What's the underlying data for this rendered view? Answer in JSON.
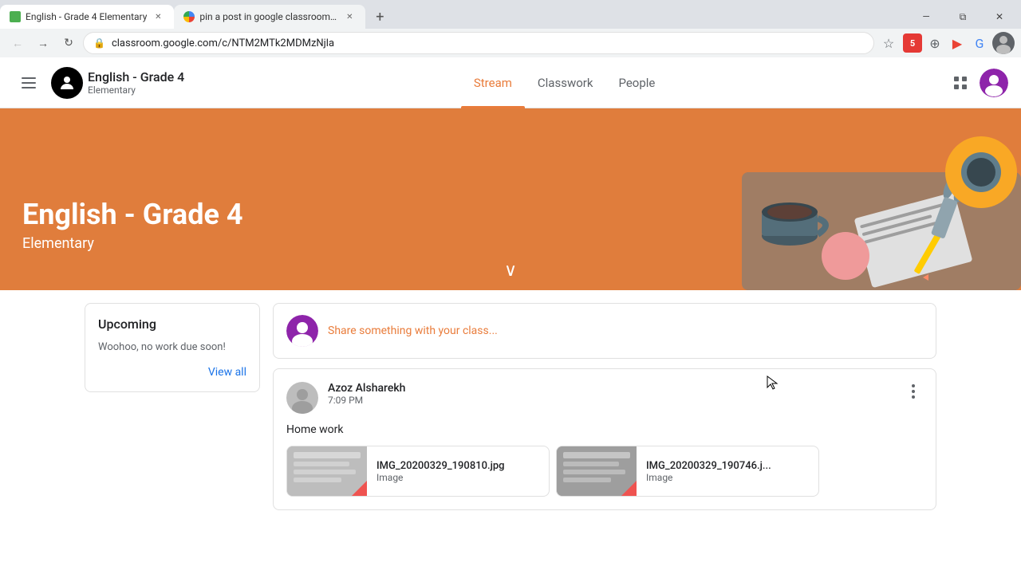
{
  "browser": {
    "tabs": [
      {
        "id": "tab1",
        "title": "English - Grade 4 Elementary",
        "active": true,
        "favicon_type": "app"
      },
      {
        "id": "tab2",
        "title": "pin a post in google classroom s...",
        "active": false,
        "favicon_type": "google"
      }
    ],
    "address": "classroom.google.com/c/NTM2MTk2MDMzNjla",
    "new_tab_tooltip": "New tab"
  },
  "header": {
    "menu_icon": "☰",
    "logo_icon": "👤",
    "title": "English - Grade 4",
    "subtitle": "Elementary",
    "nav_items": [
      {
        "id": "stream",
        "label": "Stream",
        "active": true
      },
      {
        "id": "classwork",
        "label": "Classwork",
        "active": false
      },
      {
        "id": "people",
        "label": "People",
        "active": false
      }
    ],
    "apps_icon": "⋮⋮⋮",
    "profile_alt": "User profile"
  },
  "banner": {
    "title": "English - Grade 4",
    "subtitle": "Elementary",
    "chevron": "∨"
  },
  "upcoming": {
    "title": "Upcoming",
    "empty_text": "Woohoo, no work due soon!",
    "view_all_label": "View all"
  },
  "share_box": {
    "placeholder": "Share something with your class..."
  },
  "post": {
    "author": "Azoz Alsharekh",
    "time": "7:09 PM",
    "content": "Home work",
    "attachments": [
      {
        "filename": "IMG_20200329_190810.jpg",
        "type": "Image",
        "thumb_color": "#9e9e9e"
      },
      {
        "filename": "IMG_20200329_190746.j...",
        "type": "Image",
        "thumb_color": "#9e9e9e"
      }
    ]
  },
  "colors": {
    "banner_bg": "#e07d3c",
    "active_nav": "#e97c3b",
    "link_blue": "#1a73e8"
  }
}
